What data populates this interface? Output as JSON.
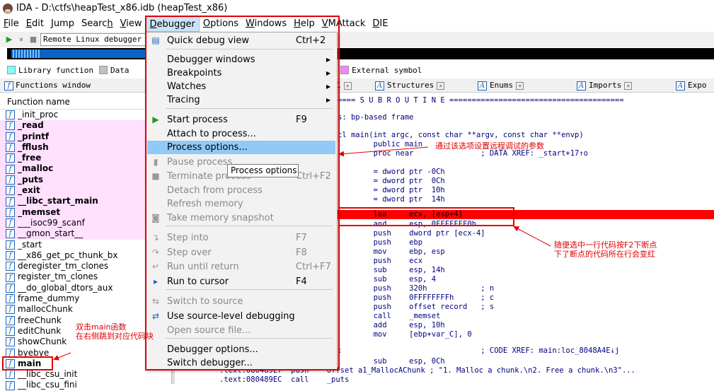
{
  "titlebar": {
    "title": "IDA - D:\\ctfs\\heapTest_x86.idb (heapTest_x86)"
  },
  "menubar": [
    {
      "label": "File",
      "key": "F",
      "rest": "ile"
    },
    {
      "label": "Edit",
      "key": "E",
      "rest": "dit"
    },
    {
      "label": "Jump",
      "key": "J",
      "rest": "ump"
    },
    {
      "label": "Search",
      "pre": "Searc",
      "key": "h",
      "rest": ""
    },
    {
      "label": "View",
      "key": "V",
      "rest": "iew"
    },
    {
      "label": "Debugger",
      "key": "D",
      "rest": "ebugger"
    },
    {
      "label": "Options",
      "key": "O",
      "rest": "ptions"
    },
    {
      "label": "Windows",
      "key": "W",
      "rest": "indows"
    },
    {
      "label": "Help",
      "key": "H",
      "rest": "elp"
    },
    {
      "label": "VMAttack",
      "key": "V",
      "rest": "MAttack"
    },
    {
      "label": "DIE",
      "key": "D",
      "rest": "IE"
    }
  ],
  "toolbar": {
    "debugger_select": "Remote Linux debugger"
  },
  "legend": [
    {
      "label": "Library function",
      "color": "#80ffff"
    },
    {
      "label": "Data",
      "color": "#c0c0c0"
    },
    {
      "label": "n",
      "color": "#ffffff"
    },
    {
      "label": "External symbol",
      "color": "#ff80ff"
    }
  ],
  "functions_window": {
    "title": "Functions window",
    "column_header": "Function name",
    "items": [
      {
        "name": "_init_proc",
        "lib": false,
        "bold": false
      },
      {
        "name": "_read",
        "lib": true,
        "bold": true
      },
      {
        "name": "_printf",
        "lib": true,
        "bold": true
      },
      {
        "name": "_fflush",
        "lib": true,
        "bold": true
      },
      {
        "name": "_free",
        "lib": true,
        "bold": true
      },
      {
        "name": "_malloc",
        "lib": true,
        "bold": true
      },
      {
        "name": "_puts",
        "lib": true,
        "bold": true
      },
      {
        "name": "_exit",
        "lib": true,
        "bold": true
      },
      {
        "name": "__libc_start_main",
        "lib": true,
        "bold": true
      },
      {
        "name": "_memset",
        "lib": true,
        "bold": true
      },
      {
        "name": "___isoc99_scanf",
        "lib": true,
        "bold": false
      },
      {
        "name": "__gmon_start__",
        "lib": true,
        "bold": false
      },
      {
        "name": "_start",
        "lib": false,
        "bold": false
      },
      {
        "name": "__x86_get_pc_thunk_bx",
        "lib": false,
        "bold": false
      },
      {
        "name": "deregister_tm_clones",
        "lib": false,
        "bold": false
      },
      {
        "name": "register_tm_clones",
        "lib": false,
        "bold": false
      },
      {
        "name": "__do_global_dtors_aux",
        "lib": false,
        "bold": false
      },
      {
        "name": "frame_dummy",
        "lib": false,
        "bold": false
      },
      {
        "name": "mallocChunk",
        "lib": false,
        "bold": false
      },
      {
        "name": "freeChunk",
        "lib": false,
        "bold": false
      },
      {
        "name": "editChunk",
        "lib": false,
        "bold": false
      },
      {
        "name": "showChunk",
        "lib": false,
        "bold": false
      },
      {
        "name": "byebye",
        "lib": false,
        "bold": false
      },
      {
        "name": "main",
        "lib": false,
        "bold": true
      },
      {
        "name": "__libc_csu_init",
        "lib": false,
        "bold": false
      },
      {
        "name": "__libc_csu_fini",
        "lib": false,
        "bold": false
      }
    ]
  },
  "tabs": [
    {
      "label": "1"
    },
    {
      "label": "Structures"
    },
    {
      "label": "Enums"
    },
    {
      "label": "Imports"
    },
    {
      "label": "Expo"
    }
  ],
  "disasm": [
    "==== S U B R O U T I N E =======================================",
    "s: bp-based frame",
    "cl main(int argc, const char **argv, const char **envp)",
    "        public main",
    "        proc near               ; DATA XREF: _start+17↑o",
    "        = dword ptr -0Ch",
    "        = dword ptr  0Ch",
    "        = dword ptr  10h",
    "        = dword ptr  14h",
    "        lea     ecx, [esp+4]",
    "        and     esp, 0FFFFFFF0h",
    "        push    dword ptr [ecx-4]",
    "        push    ebp",
    "        mov     ebp, esp",
    "        push    ecx",
    "        sub     esp, 14h",
    "        sub     esp, 4",
    "        push    320h            ; n",
    "        push    0FFFFFFFFh      ; c",
    "        push    offset record   ; s",
    "        call    _memset",
    "        add     esp, 10h",
    "        mov     [ebp+var_C], 0",
    ":                               ; CODE XREF: main:loc_8048A4E↓j",
    "        sub     esp, 0Ch",
    ".text:080489E7  push    offset a1_MallocAChunk ; \"1. Malloc a chunk.\\n2. Free a chunk.\\n3\"...",
    ".text:080489EC  call    _puts"
  ],
  "debugger_menu": [
    {
      "label": "Quick debug view",
      "shortcut": "Ctrl+2",
      "disabled": false,
      "arrow": false,
      "icon": "quick-debug-icon"
    },
    {
      "label": "Debugger windows",
      "shortcut": "",
      "disabled": false,
      "arrow": true,
      "icon": ""
    },
    {
      "label": "Breakpoints",
      "shortcut": "",
      "disabled": false,
      "arrow": true,
      "icon": ""
    },
    {
      "label": "Watches",
      "shortcut": "",
      "disabled": false,
      "arrow": true,
      "icon": ""
    },
    {
      "label": "Tracing",
      "shortcut": "",
      "disabled": false,
      "arrow": true,
      "icon": ""
    },
    {
      "label": "Start process",
      "shortcut": "F9",
      "disabled": false,
      "arrow": false,
      "icon": "play-icon"
    },
    {
      "label": "Attach to process...",
      "shortcut": "",
      "disabled": false,
      "arrow": false,
      "icon": ""
    },
    {
      "label": "Process options...",
      "shortcut": "",
      "disabled": false,
      "arrow": false,
      "icon": "",
      "selected": true
    },
    {
      "label": "Pause process",
      "shortcut": "",
      "disabled": true,
      "arrow": false,
      "icon": "pause-icon"
    },
    {
      "label": "Terminate process",
      "shortcut": "Ctrl+F2",
      "disabled": true,
      "arrow": false,
      "icon": "stop-icon"
    },
    {
      "label": "Detach from process",
      "shortcut": "",
      "disabled": true,
      "arrow": false,
      "icon": ""
    },
    {
      "label": "Refresh memory",
      "shortcut": "",
      "disabled": true,
      "arrow": false,
      "icon": ""
    },
    {
      "label": "Take memory snapshot",
      "shortcut": "",
      "disabled": true,
      "arrow": false,
      "icon": "camera-icon"
    },
    {
      "label": "Step into",
      "shortcut": "F7",
      "disabled": true,
      "arrow": false,
      "icon": "step-into-icon"
    },
    {
      "label": "Step over",
      "shortcut": "F8",
      "disabled": true,
      "arrow": false,
      "icon": "step-over-icon"
    },
    {
      "label": "Run until return",
      "shortcut": "Ctrl+F7",
      "disabled": true,
      "arrow": false,
      "icon": "run-until-return-icon"
    },
    {
      "label": "Run to cursor",
      "shortcut": "F4",
      "disabled": false,
      "arrow": false,
      "icon": "run-to-cursor-icon"
    },
    {
      "label": "Switch to source",
      "shortcut": "",
      "disabled": true,
      "arrow": false,
      "icon": "switch-source-icon"
    },
    {
      "label": "Use source-level debugging",
      "shortcut": "",
      "disabled": false,
      "arrow": false,
      "icon": "source-debug-icon"
    },
    {
      "label": "Open source file...",
      "shortcut": "",
      "disabled": true,
      "arrow": false,
      "icon": ""
    },
    {
      "label": "Debugger options...",
      "shortcut": "",
      "disabled": false,
      "arrow": false,
      "icon": ""
    },
    {
      "label": "Switch debugger...",
      "shortcut": "",
      "disabled": false,
      "arrow": false,
      "icon": ""
    }
  ],
  "tooltip": "Process options",
  "annotations": {
    "process_options": "通过该选项设置远程调试的参数",
    "breakpoint": "随便选中一行代码按F2下断点\n下了断点的代码所在行会变红",
    "main": "双击main函数\n在右侧跳到对应代码块"
  },
  "colors": {
    "lib_bg": "#ffe0ff",
    "breakpoint": "#ff0000",
    "selected": "#91c9f7",
    "annotation": "#e00000"
  }
}
